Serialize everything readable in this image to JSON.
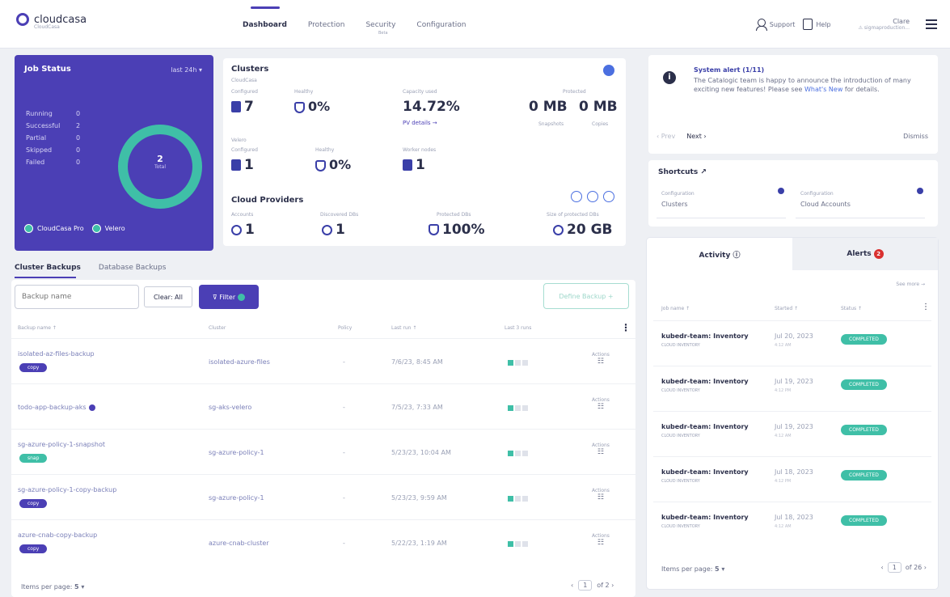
{
  "brand": {
    "name": "cloudcasa",
    "tagline": "CloudCasa"
  },
  "nav": {
    "items": [
      "Dashboard",
      "Protection",
      "Security",
      "Configuration"
    ],
    "security_sub": "Beta"
  },
  "topright": {
    "support": "Support",
    "help": "Help",
    "user": "Clare",
    "org": "⚠ sigmaproduction..."
  },
  "job_status": {
    "title": "Job Status",
    "range": "last 24h ▾",
    "rows": [
      {
        "label": "Running",
        "value": "0"
      },
      {
        "label": "Successful",
        "value": "2"
      },
      {
        "label": "Partial",
        "value": "0"
      },
      {
        "label": "Skipped",
        "value": "0"
      },
      {
        "label": "Failed",
        "value": "0"
      }
    ],
    "total_value": "2",
    "total_label": "Total",
    "filters": [
      "CloudCasa Pro",
      "Velero"
    ]
  },
  "clusters": {
    "title": "Clusters",
    "cloudcasa_label": "CloudCasa",
    "configured_label": "Configured",
    "configured": "7",
    "healthy_label": "Healthy",
    "healthy": "0%",
    "capacity_label": "Capacity used",
    "capacity": "14.72%",
    "pv_link": "PV details →",
    "protected_label": "Protected",
    "snapshots": "0 MB",
    "snapshots_label": "Snapshots",
    "copies": "0 MB",
    "copies_label": "Copies",
    "velero_label": "Velero",
    "v_configured_label": "Configured",
    "v_configured": "1",
    "v_healthy_label": "Healthy",
    "v_healthy": "0%",
    "worker_label": "Worker nodes",
    "worker": "1"
  },
  "providers": {
    "title": "Cloud Providers",
    "accounts_label": "Accounts",
    "accounts": "1",
    "discovered_label": "Discovered DBs",
    "discovered": "1",
    "protected_label": "Protected DBs",
    "protected": "100%",
    "size_label": "Size of protected DBs",
    "size": "20 GB"
  },
  "backups": {
    "tabs": [
      "Cluster Backups",
      "Database Backups"
    ],
    "search_placeholder": "Backup name",
    "clear": "Clear: All",
    "filter": "Filter",
    "define": "Define Backup +",
    "headers": [
      "Backup name ↑",
      "Cluster",
      "Policy",
      "Last run ↑",
      "Last 3 runs"
    ],
    "actions_label": "Actions",
    "actions_icon": "☷",
    "rows": [
      {
        "name": "isolated-az-files-backup",
        "tag": "copy",
        "green": false,
        "cluster": "isolated-azure-files",
        "policy": "-",
        "last_run": "7/6/23, 8:45 AM",
        "badge": false
      },
      {
        "name": "todo-app-backup-aks",
        "tag": "",
        "green": false,
        "cluster": "sg-aks-velero",
        "policy": "-",
        "last_run": "7/5/23, 7:33 AM",
        "badge": true
      },
      {
        "name": "sg-azure-policy-1-snapshot",
        "tag": "snap",
        "green": true,
        "cluster": "sg-azure-policy-1",
        "policy": "-",
        "last_run": "5/23/23, 10:04 AM",
        "badge": false
      },
      {
        "name": "sg-azure-policy-1-copy-backup",
        "tag": "copy",
        "green": false,
        "cluster": "sg-azure-policy-1",
        "policy": "-",
        "last_run": "5/23/23, 9:59 AM",
        "badge": false
      },
      {
        "name": "azure-cnab-copy-backup",
        "tag": "copy",
        "green": false,
        "cluster": "azure-cnab-cluster",
        "policy": "-",
        "last_run": "5/22/23, 1:19 AM",
        "badge": false
      }
    ],
    "per_page_label": "Items per page:",
    "per_page": "5 ▾",
    "page": "1",
    "of_pages": "of 2 ›"
  },
  "alert": {
    "title": "System alert (1/11)",
    "text": "The Catalogic team is happy to announce the introduction of many exciting new features! Please see ",
    "link": "What's New",
    "text_end": " for details.",
    "prev": "‹ Prev",
    "next": "Next ›",
    "dismiss": "Dismiss"
  },
  "shortcuts": {
    "title": "Shortcuts ↗",
    "items": [
      {
        "label": "Configuration",
        "value": "Clusters"
      },
      {
        "label": "Configuration",
        "value": "Cloud Accounts"
      }
    ]
  },
  "activity": {
    "tab_activity": "Activity ⓘ",
    "tab_alerts": "Alerts",
    "alerts_count": "2",
    "see_more": "See more →",
    "headers": [
      "Job name ↑",
      "Started ↑",
      "Status ↑"
    ],
    "rows": [
      {
        "name": "kubedr-team: Inventory",
        "sub": "CLOUD INVENTORY",
        "date": "Jul 20, 2023",
        "time": "4:12 AM",
        "status": "COMPLETED"
      },
      {
        "name": "kubedr-team: Inventory",
        "sub": "CLOUD INVENTORY",
        "date": "Jul 19, 2023",
        "time": "4:12 PM",
        "status": "COMPLETED"
      },
      {
        "name": "kubedr-team: Inventory",
        "sub": "CLOUD INVENTORY",
        "date": "Jul 19, 2023",
        "time": "4:12 AM",
        "status": "COMPLETED"
      },
      {
        "name": "kubedr-team: Inventory",
        "sub": "CLOUD INVENTORY",
        "date": "Jul 18, 2023",
        "time": "4:12 PM",
        "status": "COMPLETED"
      },
      {
        "name": "kubedr-team: Inventory",
        "sub": "CLOUD INVENTORY",
        "date": "Jul 18, 2023",
        "time": "4:12 AM",
        "status": "COMPLETED"
      }
    ],
    "per_page_label": "Items per page:",
    "per_page": "5 ▾",
    "page": "1",
    "of_pages": "of 26 ›"
  }
}
